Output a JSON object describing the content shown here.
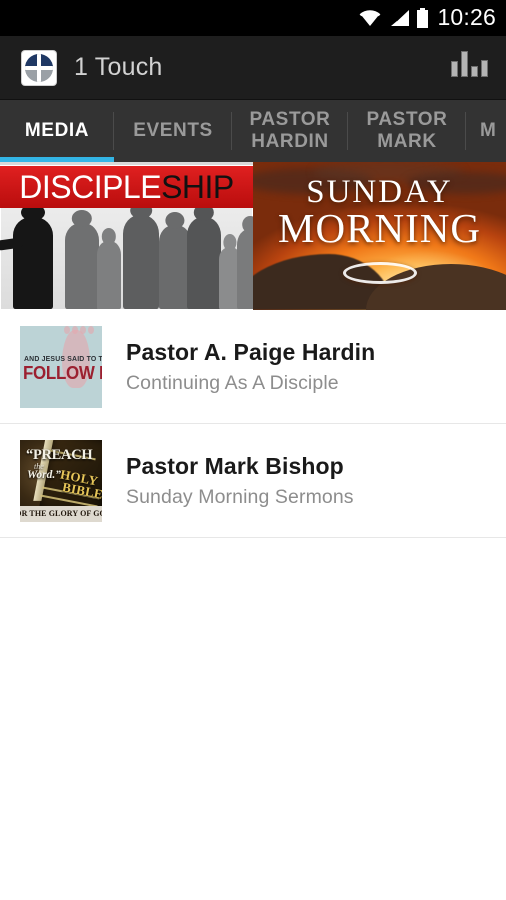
{
  "status_bar": {
    "time": "10:26",
    "wifi_icon": "wifi-icon",
    "signal_icon": "cellular-signal-icon",
    "battery_icon": "battery-full-icon"
  },
  "action_bar": {
    "app_icon": "church-cross-logo-icon",
    "title": "1 Touch",
    "equalizer_icon": "equalizer-icon"
  },
  "tabs": [
    {
      "label": "MEDIA",
      "active": true
    },
    {
      "label": "EVENTS",
      "active": false
    },
    {
      "label": "PASTOR\nHARDIN",
      "active": false
    },
    {
      "label": "PASTOR\nMARK",
      "active": false
    },
    {
      "label": "M",
      "active": false
    }
  ],
  "banners": [
    {
      "name": "discipleship-banner",
      "title_part_1": "DISCIPLE",
      "title_part_2": "SHIP",
      "alt": "Silhouettes of people following a preacher"
    },
    {
      "name": "sunday-morning-banner",
      "line_1": "SUNDAY",
      "line_2": "MORNING",
      "alt": "Sunrise over mountains"
    }
  ],
  "media_list": [
    {
      "thumb": "follow-me-thumbnail",
      "thumb_text_small": "AND JESUS SAID TO THEM",
      "thumb_text_large": "FOLLOW ME",
      "title": "Pastor A. Paige Hardin",
      "subtitle": "Continuing As A Disciple"
    },
    {
      "thumb": "preach-the-word-thumbnail",
      "thumb_text_1": "“PREACH",
      "thumb_text_2": "the",
      "thumb_text_3": "Word.”",
      "thumb_text_4": "HOLY",
      "thumb_text_5": "BIBLE",
      "thumb_text_6": "FOR THE GLORY OF GOD",
      "title": "Pastor Mark Bishop",
      "subtitle": "Sunday Morning Sermons"
    }
  ],
  "colors": {
    "accent": "#33b5e5",
    "action_bar_bg": "#1e1e1e",
    "tab_bar_bg": "#333333",
    "status_bar_bg": "#000000",
    "title_text": "#1a1a1a",
    "subtitle_text": "#8d8d8d",
    "banner_red": "#d01a1a"
  }
}
